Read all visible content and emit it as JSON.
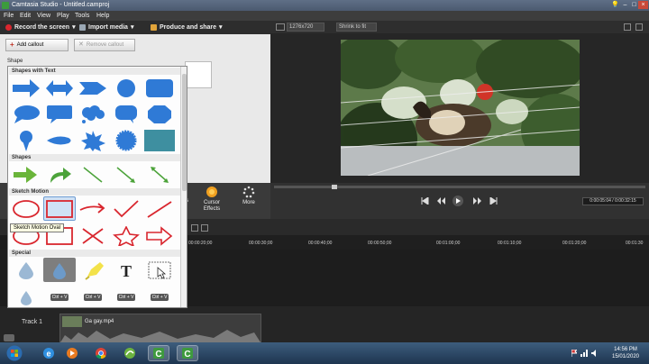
{
  "window": {
    "title": "Camtasia Studio - Untitled.camproj"
  },
  "menu": [
    "File",
    "Edit",
    "View",
    "Play",
    "Tools",
    "Help"
  ],
  "toolbar": {
    "record": "Record the screen",
    "import": "Import media",
    "produce": "Produce and share"
  },
  "callouts": {
    "add": "Add callout",
    "remove": "Remove callout",
    "shape_label": "Shape"
  },
  "shape_menu": {
    "sections": [
      "Shapes with Text",
      "Shapes",
      "Sketch Motion",
      "Special"
    ],
    "tooltip": "Sketch Motion Oval",
    "ctrl_v": "Ctrl + V"
  },
  "tasks": {
    "partial": "ns",
    "cursor_effects": "Cursor Effects",
    "more": "More"
  },
  "preview": {
    "resolution": "1276x720",
    "zoom": "Shrink to fit",
    "time": "0:00:05:04 / 0:00:32:15"
  },
  "timeline": {
    "ticks": [
      "00:00:20;00",
      "00:00:30;00",
      "00:00:40;00",
      "00:00:50;00",
      "00:01:00;00",
      "00:01:10;00",
      "00:01:20;00",
      "00:01:30"
    ],
    "track": "Track 1",
    "clip": "Ga gay.mp4"
  },
  "clock": {
    "time": "14:56 PM",
    "date": "15/01/2020"
  },
  "colors": {
    "accent": "#3b7fd4",
    "shape_blue": "#2f7ad6",
    "sketch_red": "#d9262e",
    "teal": "#3e8fa0"
  }
}
